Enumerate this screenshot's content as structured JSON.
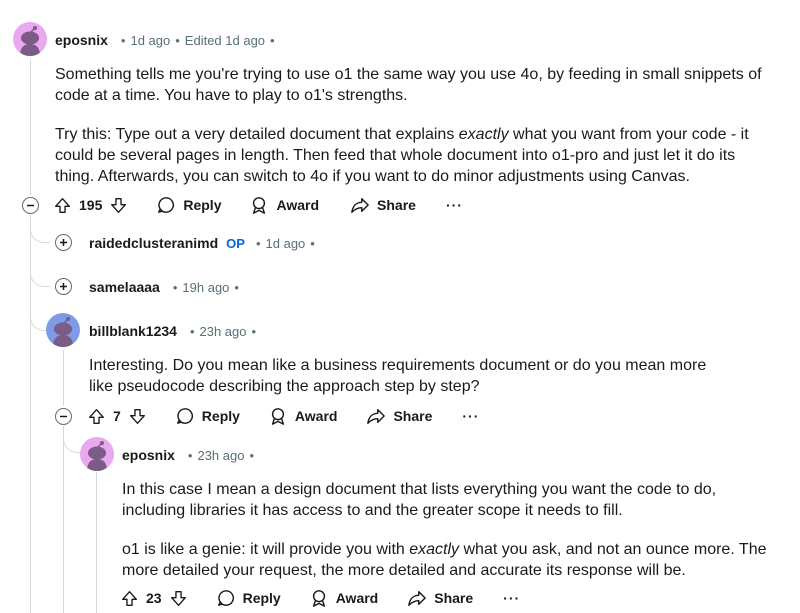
{
  "comments": [
    {
      "username": "eposnix",
      "time": "1d ago",
      "edited": "Edited 1d ago",
      "paragraphs": [
        [
          "Something tells me you're trying to use o1 the same way you use 4o, by feeding in small snippets of code at a time. You have to play to o1's strengths."
        ],
        [
          "Try this: Type out a very detailed document that explains ",
          "exactly",
          " what you want from your code - it could be several pages in length. Then feed that whole document into o1-pro and just let it do its thing. Afterwards, you can switch to 4o if you want to do minor adjustments using Canvas."
        ]
      ],
      "score": "195",
      "reply_label": "Reply",
      "award_label": "Award",
      "share_label": "Share",
      "more_label": "···"
    },
    {
      "username": "raidedclusteranimd",
      "op_badge": "OP",
      "time": "1d ago"
    },
    {
      "username": "samelaaaa",
      "time": "19h ago"
    },
    {
      "username": "billblank1234",
      "time": "23h ago",
      "paragraphs": [
        [
          "Interesting. Do you mean like a business requirements document or do you mean more like pseudocode describing the approach step by step?"
        ]
      ],
      "score": "7",
      "reply_label": "Reply",
      "award_label": "Award",
      "share_label": "Share",
      "more_label": "···"
    },
    {
      "username": "eposnix",
      "time": "23h ago",
      "paragraphs": [
        [
          "In this case I mean a design document that lists everything you want the code to do, including libraries it has access to and the greater scope it needs to fill."
        ],
        [
          "o1 is like a genie: it will provide you with ",
          "exactly",
          " what you ask, and not an ounce more. The more detailed your request, the more detailed and accurate its response will be."
        ]
      ],
      "score": "23",
      "reply_label": "Reply",
      "award_label": "Award",
      "share_label": "Share",
      "more_label": "···"
    }
  ],
  "colors": {
    "avatar_pink": "#e9a8f0",
    "avatar_blue": "#7f9be6",
    "snoo_body": "#7a5c87",
    "meta_gray": "#576f76",
    "op_blue": "#0a63d6",
    "thread_line": "#d3dbde"
  },
  "icons": [
    "minus-circle-icon",
    "plus-circle-icon",
    "upvote-icon",
    "downvote-icon",
    "reply-bubble-icon",
    "award-icon",
    "share-icon"
  ]
}
